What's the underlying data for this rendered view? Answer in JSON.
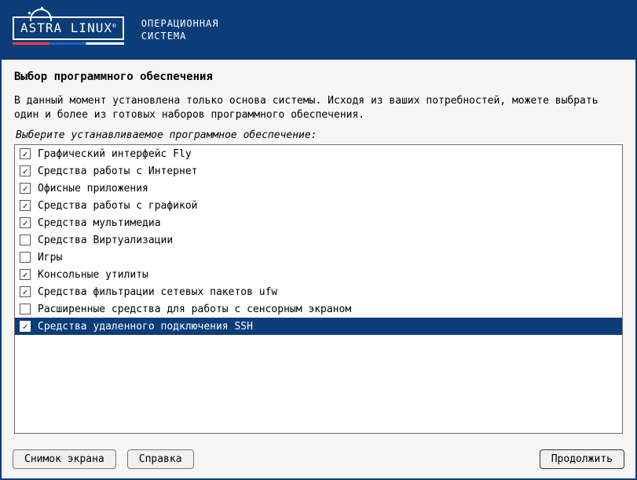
{
  "header": {
    "logo_text": "ASTRA LINUX",
    "logo_reg": "®",
    "subtitle_line1": "ОПЕРАЦИОННАЯ",
    "subtitle_line2": "СИСТЕМА"
  },
  "title": "Выбор программного обеспечения",
  "description": "В данный момент установлена только основа системы. Исходя из ваших потребностей, можете выбрать один и более из готовых наборов программного обеспечения.",
  "subtitle": "Выберите устанавливаемое программное обеспечение:",
  "items": [
    {
      "label": "Графический интерфейс Fly",
      "checked": true,
      "selected": false
    },
    {
      "label": "Средства работы с Интернет",
      "checked": true,
      "selected": false
    },
    {
      "label": "Офисные приложения",
      "checked": true,
      "selected": false
    },
    {
      "label": "Средства работы с графикой",
      "checked": true,
      "selected": false
    },
    {
      "label": "Средства мультимедиа",
      "checked": true,
      "selected": false
    },
    {
      "label": "Средства Виртуализации",
      "checked": false,
      "selected": false
    },
    {
      "label": "Игры",
      "checked": false,
      "selected": false
    },
    {
      "label": "Консольные утилиты",
      "checked": true,
      "selected": false
    },
    {
      "label": "Средства фильтрации сетевых пакетов ufw",
      "checked": true,
      "selected": false
    },
    {
      "label": "Расширенные средства для работы с сенсорным экраном",
      "checked": false,
      "selected": false
    },
    {
      "label": "Средства удаленного подключения SSH",
      "checked": true,
      "selected": true
    }
  ],
  "footer": {
    "screenshot": "Снимок экрана",
    "help": "Справка",
    "continue": "Продолжить"
  }
}
